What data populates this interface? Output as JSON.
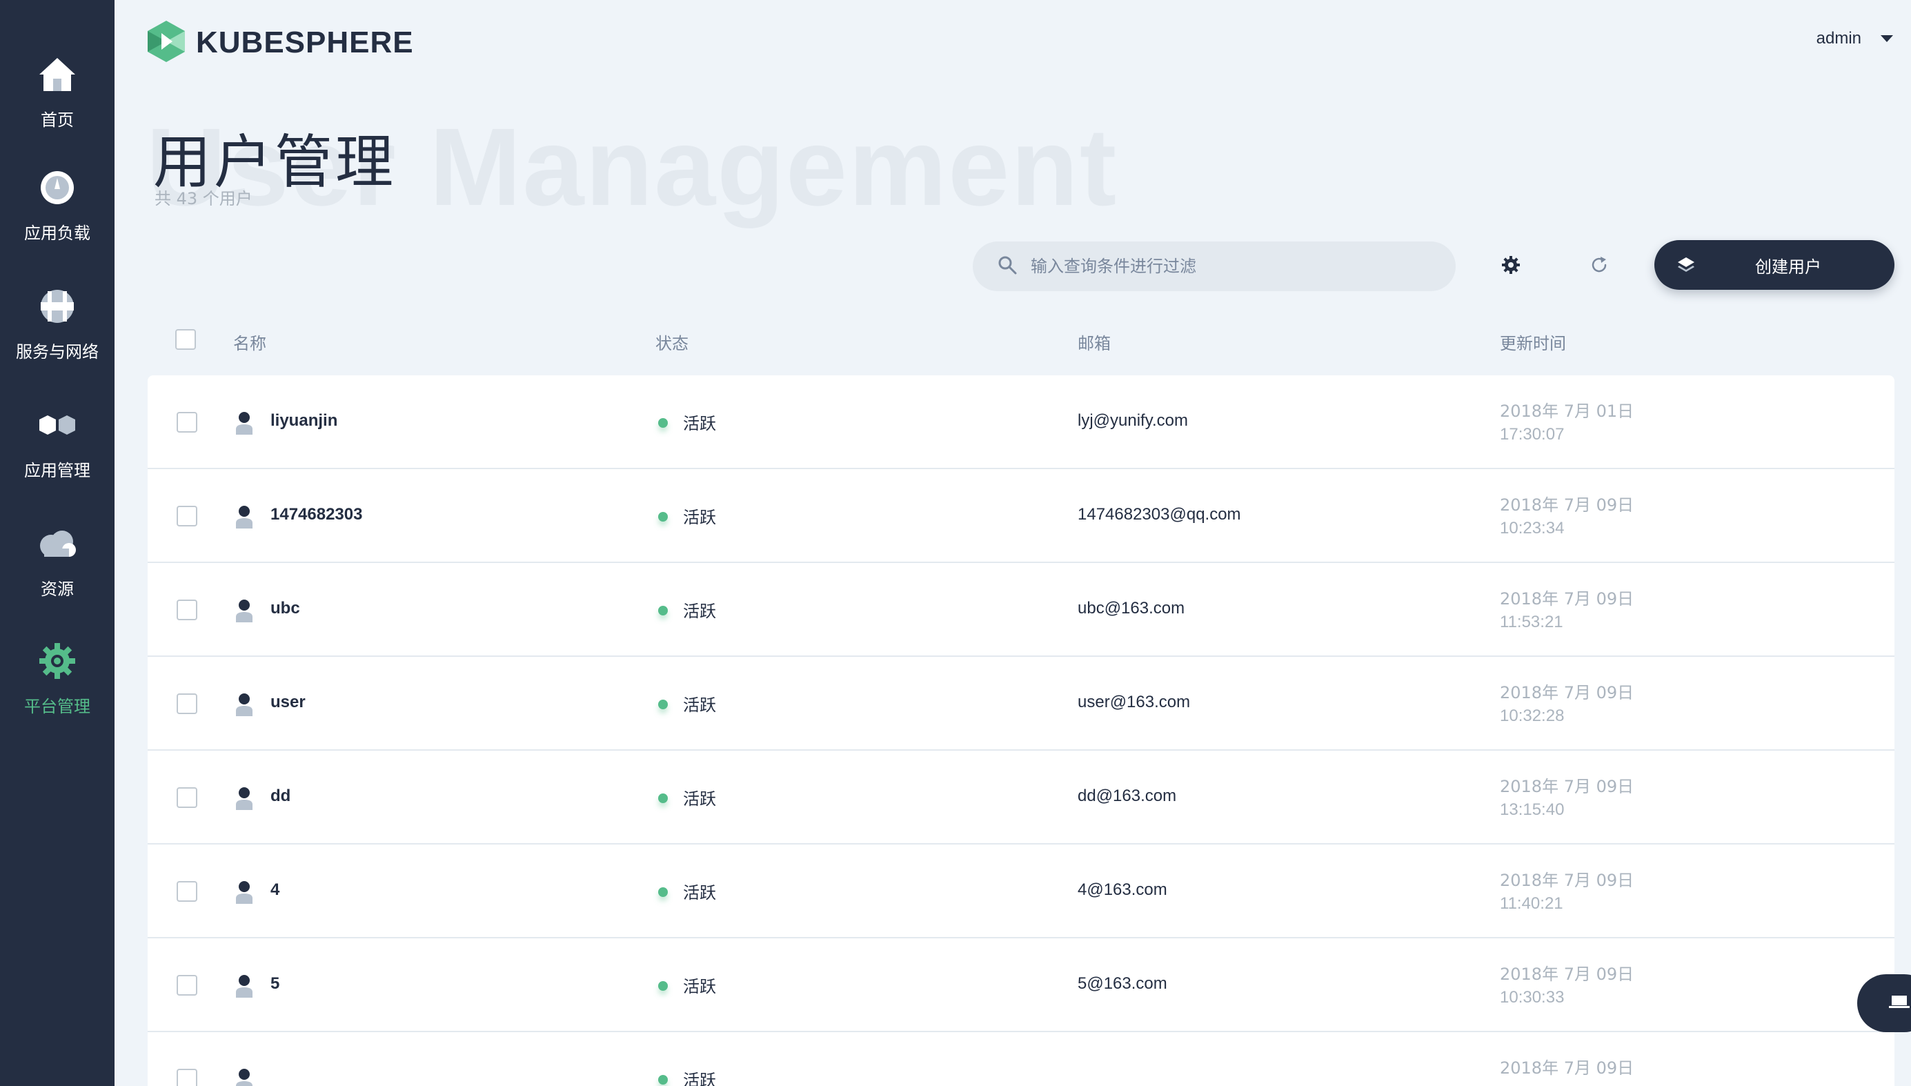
{
  "sidebar": {
    "items": [
      {
        "label": "首页",
        "icon": "home-icon"
      },
      {
        "label": "应用负载",
        "icon": "dashboard-icon"
      },
      {
        "label": "服务与网络",
        "icon": "network-icon"
      },
      {
        "label": "应用管理",
        "icon": "apps-icon"
      },
      {
        "label": "资源",
        "icon": "cloud-icon"
      },
      {
        "label": "平台管理",
        "icon": "gear-icon"
      }
    ],
    "active_index": 5
  },
  "header": {
    "logo_text": "KUBESPHERE",
    "user": "admin"
  },
  "page": {
    "watermark": "User Management",
    "title": "用户管理",
    "subtitle": "共 43 个用户"
  },
  "toolbar": {
    "search_placeholder": "输入查询条件进行过滤",
    "create_label": "创建用户"
  },
  "table": {
    "columns": [
      "名称",
      "状态",
      "邮箱",
      "更新时间"
    ],
    "rows": [
      {
        "name": "liyuanjin",
        "status": "活跃",
        "email": "lyj@yunify.com",
        "date": "2018年 7月 01日",
        "time": "17:30:07"
      },
      {
        "name": "1474682303",
        "status": "活跃",
        "email": "1474682303@qq.com",
        "date": "2018年 7月 09日",
        "time": "10:23:34"
      },
      {
        "name": "ubc",
        "status": "活跃",
        "email": "ubc@163.com",
        "date": "2018年 7月 09日",
        "time": "11:53:21"
      },
      {
        "name": "user",
        "status": "活跃",
        "email": "user@163.com",
        "date": "2018年 7月 09日",
        "time": "10:32:28"
      },
      {
        "name": "dd",
        "status": "活跃",
        "email": "dd@163.com",
        "date": "2018年 7月 09日",
        "time": "13:15:40"
      },
      {
        "name": "4",
        "status": "活跃",
        "email": "4@163.com",
        "date": "2018年 7月 09日",
        "time": "11:40:21"
      },
      {
        "name": "5",
        "status": "活跃",
        "email": "5@163.com",
        "date": "2018年 7月 09日",
        "time": "10:30:33"
      },
      {
        "name": "",
        "status": "活跃",
        "email": "",
        "date": "2018年 7月 09日",
        "time": ""
      }
    ]
  },
  "colors": {
    "sidebar_bg": "#242e42",
    "accent": "#55bc8a",
    "page_bg": "#eff4f9"
  }
}
